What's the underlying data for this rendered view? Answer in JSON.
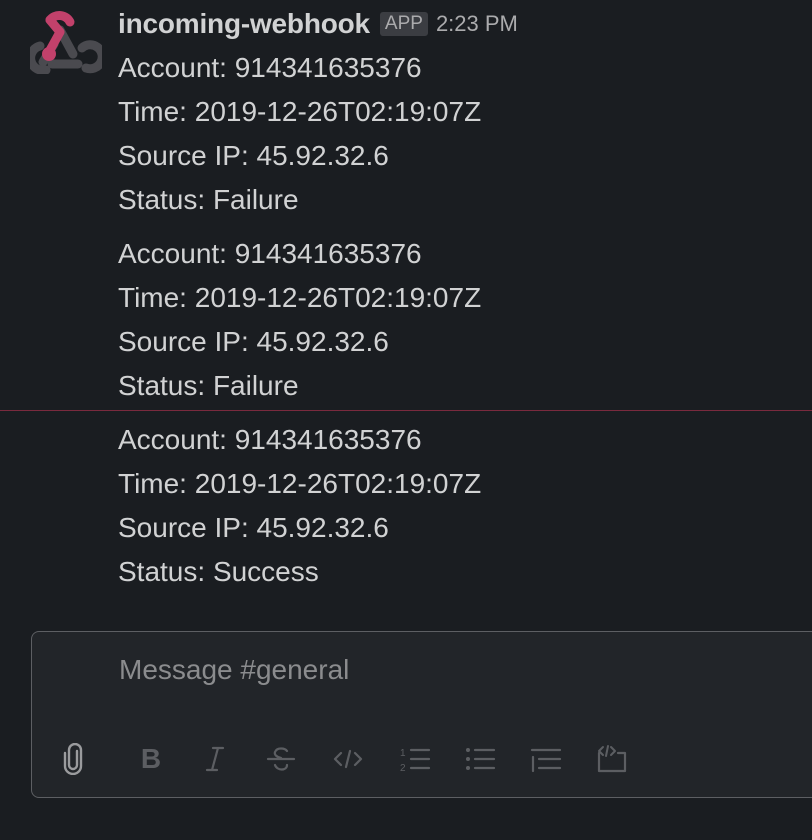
{
  "message": {
    "sender": "incoming-webhook",
    "badge": "APP",
    "time": "2:23 PM",
    "avatar_icon": "webhook-logo-icon",
    "blocks": [
      {
        "account": "Account: 914341635376",
        "time": "Time: 2019-12-26T02:19:07Z",
        "source_ip": "Source IP: 45.92.32.6",
        "status": "Status: Failure"
      },
      {
        "account": "Account: 914341635376",
        "time": "Time: 2019-12-26T02:19:07Z",
        "source_ip": "Source IP: 45.92.32.6",
        "status": "Status: Failure"
      },
      {
        "account": "Account: 914341635376",
        "time": "Time: 2019-12-26T02:19:07Z",
        "source_ip": "Source IP: 45.92.32.6",
        "status": "Status: Success"
      }
    ]
  },
  "composer": {
    "placeholder": "Message #general",
    "tools": [
      "paperclip-icon",
      "bold-icon",
      "italic-icon",
      "strikethrough-icon",
      "code-icon",
      "ordered-list-icon",
      "bulleted-list-icon",
      "blockquote-icon",
      "code-block-icon"
    ]
  },
  "colors": {
    "background": "#1a1d21",
    "text": "#d1d2d3",
    "muted": "#ababad",
    "new_message_divider": "#7a2a3e",
    "composer_border": "#5d5f63",
    "avatar_pink": "#c2416b",
    "avatar_gray": "#4a4a4f"
  }
}
